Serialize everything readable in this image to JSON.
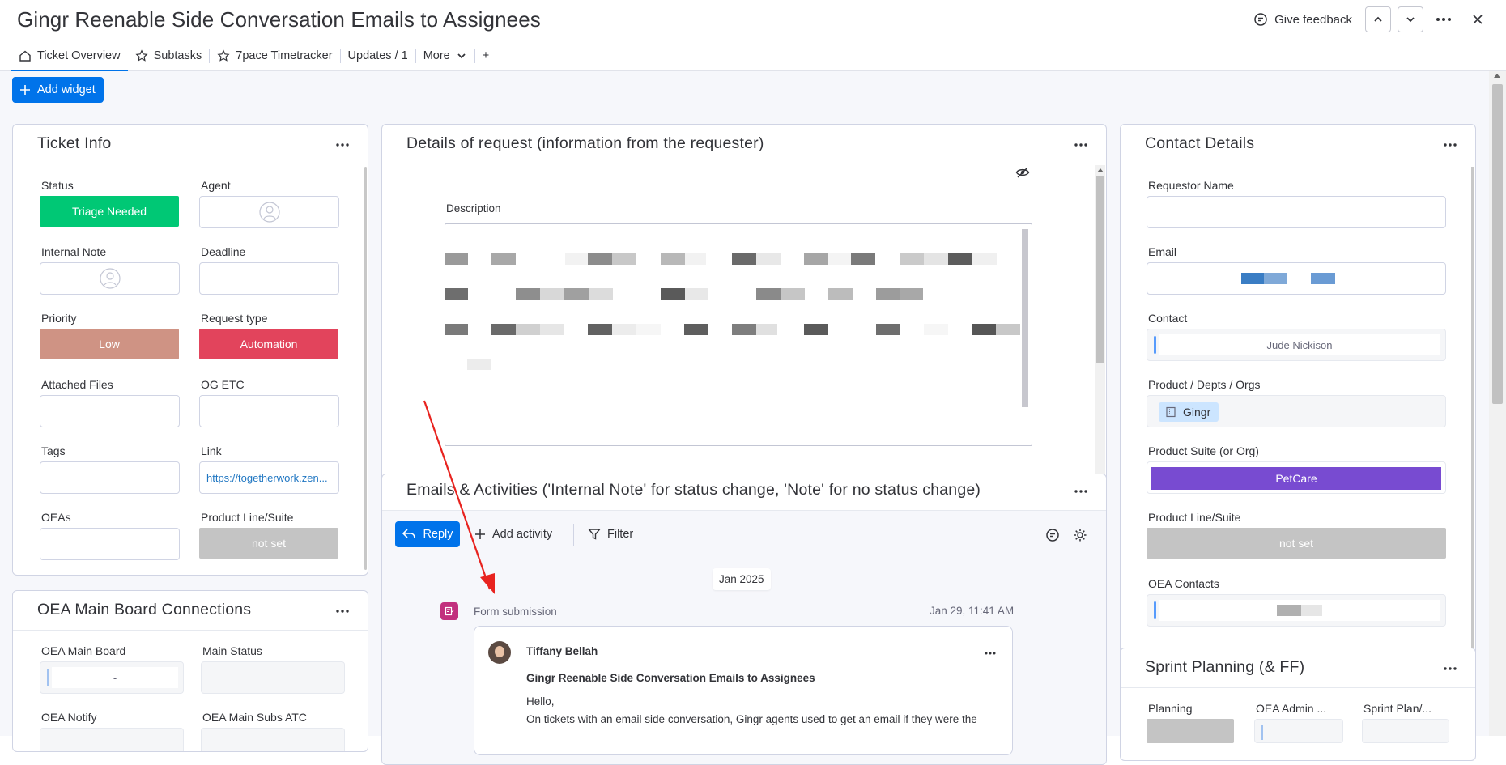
{
  "header": {
    "title": "Gingr Reenable Side Conversation Emails to Assignees",
    "feedback_label": "Give feedback"
  },
  "tabs": [
    {
      "label": "Ticket Overview",
      "icon": "home-icon"
    },
    {
      "label": "Subtasks",
      "icon": "star-icon"
    },
    {
      "label": "7pace Timetracker",
      "icon": "star-icon"
    },
    {
      "label": "Updates / 1"
    },
    {
      "label": "More",
      "icon": "chevron-down-icon"
    },
    {
      "label": "+"
    }
  ],
  "add_widget_label": "Add widget",
  "ticket_info": {
    "title": "Ticket Info",
    "fields": [
      {
        "label": "Status",
        "value": "Triage Needed",
        "color": "#00c875"
      },
      {
        "label": "Agent",
        "value": ""
      },
      {
        "label": "Internal Note",
        "value": ""
      },
      {
        "label": "Deadline",
        "value": ""
      },
      {
        "label": "Priority",
        "value": "Low",
        "color": "#cf9384"
      },
      {
        "label": "Request type",
        "value": "Automation",
        "color": "#e2445c"
      },
      {
        "label": "Attached Files",
        "value": ""
      },
      {
        "label": "OG ETC",
        "value": ""
      },
      {
        "label": "Tags",
        "value": ""
      },
      {
        "label": "Link",
        "value": "https://togetherwork.zen..."
      },
      {
        "label": "OEAs",
        "value": ""
      },
      {
        "label": "Product Line/Suite",
        "value": "not set",
        "color": "#c4c4c4"
      }
    ]
  },
  "oea_board": {
    "title": "OEA Main Board Connections",
    "fields": [
      {
        "label": "OEA Main Board",
        "value": "-"
      },
      {
        "label": "Main Status",
        "value": ""
      },
      {
        "label": "OEA Notify",
        "value": ""
      },
      {
        "label": "OEA Main Subs ATC",
        "value": ""
      }
    ]
  },
  "details": {
    "title": "Details of request (information from the requester)",
    "description_label": "Description"
  },
  "activities": {
    "title": "Emails & Activities ('Internal Note' for status change, 'Note' for no status change)",
    "reply_label": "Reply",
    "add_activity_label": "Add activity",
    "filter_label": "Filter",
    "date_chip": "Jan 2025",
    "entry": {
      "type": "Form submission",
      "time": "Jan 29, 11:41 AM",
      "author": "Tiffany Bellah",
      "subject": "Gingr Reenable Side Conversation Emails to Assignees",
      "greeting": "Hello,",
      "body_start": "On tickets with an email side conversation, Gingr agents used to get an email if they were the"
    }
  },
  "contact": {
    "title": "Contact Details",
    "fields": [
      {
        "label": "Requestor Name",
        "value": ""
      },
      {
        "label": "Email",
        "value": ""
      },
      {
        "label": "Contact",
        "value": "Jude Nickison"
      },
      {
        "label": "Product / Depts / Orgs",
        "value": "Gingr"
      },
      {
        "label": "Product Suite (or Org)",
        "value": "PetCare",
        "color": "#784bd1"
      },
      {
        "label": "Product Line/Suite",
        "value": "not set",
        "color": "#c4c4c4"
      },
      {
        "label": "OEA Contacts",
        "value": ""
      }
    ]
  },
  "sprint": {
    "title": "Sprint Planning (& FF)",
    "fields": [
      {
        "label": "Planning"
      },
      {
        "label": "OEA Admin ..."
      },
      {
        "label": "Sprint Plan/..."
      }
    ]
  }
}
